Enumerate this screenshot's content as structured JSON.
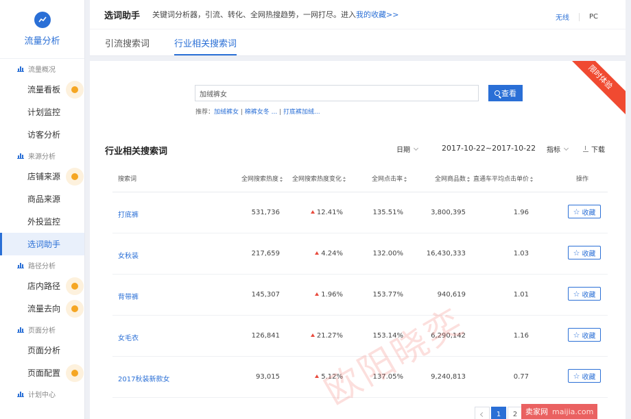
{
  "sidebar": {
    "brand_title": "流量分析",
    "groups": [
      {
        "label": "流量概况",
        "items": [
          {
            "label": "流量看板",
            "dot": true
          },
          {
            "label": "计划监控",
            "dot": false
          },
          {
            "label": "访客分析",
            "dot": false
          }
        ]
      },
      {
        "label": "来源分析",
        "items": [
          {
            "label": "店铺来源",
            "dot": true
          },
          {
            "label": "商品来源",
            "dot": false
          },
          {
            "label": "外投监控",
            "dot": false
          },
          {
            "label": "选词助手",
            "dot": false,
            "active": true
          }
        ]
      },
      {
        "label": "路径分析",
        "items": [
          {
            "label": "店内路径",
            "dot": true
          },
          {
            "label": "流量去向",
            "dot": true
          }
        ]
      },
      {
        "label": "页面分析",
        "items": [
          {
            "label": "页面分析",
            "dot": false
          },
          {
            "label": "页面配置",
            "dot": true
          }
        ]
      },
      {
        "label": "计划中心",
        "items": []
      }
    ]
  },
  "header": {
    "title": "选词助手",
    "desc": "关键词分析器，引流、转化、全网热搜趋势，一网打尽。进入",
    "fav_link": "我的收藏>>",
    "wireless": "无线",
    "pc": "PC",
    "tabs": [
      "引流搜索词",
      "行业相关搜索词"
    ],
    "active_tab": 1
  },
  "ribbon": "限时体验",
  "search": {
    "value": "加绒裤女",
    "button": "查看",
    "rec_label": "推荐：",
    "rec": [
      "加绒裤女",
      "棉裤女冬 ...",
      "打底裤加绒..."
    ]
  },
  "section": {
    "title": "行业相关搜索词",
    "date_label": "日期",
    "date_range": "2017-10-22~2017-10-22",
    "metric_label": "指标",
    "download": "下载"
  },
  "table": {
    "columns": [
      "搜索词",
      "全网搜索热度",
      "全网搜索热度变化",
      "全网点击率",
      "全网商品数",
      "直通车平均点击单价",
      "操作"
    ],
    "fav_label": "收藏",
    "rows": [
      {
        "kw": "打底裤",
        "heat": "531,736",
        "change": "12.41%",
        "ctr": "135.51%",
        "items": "3,800,395",
        "cpc": "1.96"
      },
      {
        "kw": "女秋装",
        "heat": "217,659",
        "change": "4.24%",
        "ctr": "132.00%",
        "items": "16,430,333",
        "cpc": "1.03"
      },
      {
        "kw": "背带裤",
        "heat": "145,307",
        "change": "1.96%",
        "ctr": "153.77%",
        "items": "940,619",
        "cpc": "1.01"
      },
      {
        "kw": "女毛衣",
        "heat": "126,841",
        "change": "21.27%",
        "ctr": "153.14%",
        "items": "6,290,142",
        "cpc": "1.16"
      },
      {
        "kw": "2017秋装新款女",
        "heat": "93,015",
        "change": "5.12%",
        "ctr": "137.05%",
        "items": "9,240,813",
        "cpc": "0.77"
      }
    ]
  },
  "pager": {
    "pages": [
      "1",
      "2"
    ],
    "active": "1"
  },
  "watermark": "欧阳晓奕",
  "site_mark": {
    "name": "卖家网",
    "url": "maijia.com"
  }
}
